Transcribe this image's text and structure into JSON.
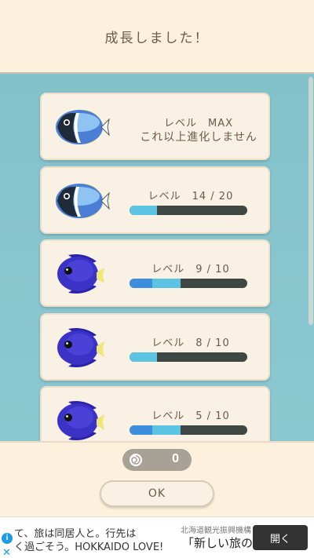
{
  "header": {
    "title": "成長しました！"
  },
  "cards": [
    {
      "kind": "max",
      "level_text": "レベル　MAX",
      "subtext": "これ以上進化しません",
      "fish": "powder-blue-tang-icon"
    },
    {
      "kind": "bar",
      "level_text": "レベル　14 / 20",
      "progress": 0.23,
      "fish": "powder-blue-tang-icon"
    },
    {
      "kind": "bar",
      "level_text": "レベル　9 / 10",
      "progress": 0.43,
      "fish": "purple-tang-icon"
    },
    {
      "kind": "bar",
      "level_text": "レベル　8 / 10",
      "progress": 0.23,
      "fish": "purple-tang-icon"
    },
    {
      "kind": "bar",
      "level_text": "レベル　5 / 10",
      "progress": 0.43,
      "fish": "purple-tang-icon"
    }
  ],
  "footer": {
    "currency_icon": "shell-icon",
    "currency_value": "0",
    "ok_label": "OK"
  },
  "ad": {
    "line1": "て、旅は同居人と。行先は",
    "line2": "く過ごそう。HOKKAIDO LOVE!",
    "sponsor": "北海道観光振興機構",
    "headline": "「新しい旅の",
    "open_label": "開く"
  },
  "colors": {
    "bar_fill": "#5cc3e3",
    "bar_track": "#3e4743",
    "panel_bg": "#8cc8d1",
    "cream": "#fdf1de"
  }
}
